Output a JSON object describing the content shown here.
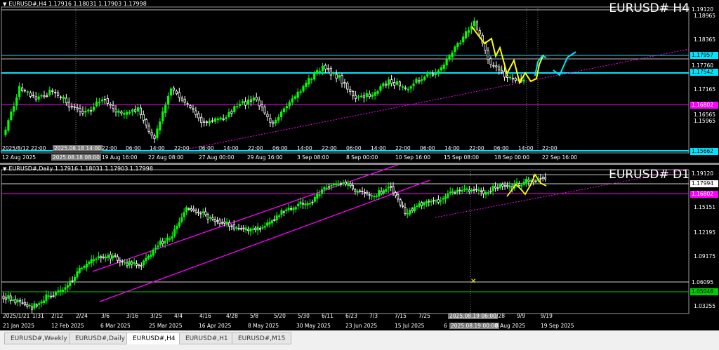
{
  "charts": [
    {
      "id": "h4",
      "header": "EURUSD#,H4  1.17916 1.18031 1.17903 1.17998",
      "watermark": "EURUSD# H4",
      "price_labels": [
        {
          "text": "1.19120",
          "bg": "#000000",
          "fg": "#ffffff"
        },
        {
          "text": "1.17957",
          "bg": "#00e5ff",
          "fg": "#000000"
        },
        {
          "text": "1.17760",
          "bg": "#000000",
          "fg": "#ffffff"
        },
        {
          "text": "1.17542",
          "bg": "#00e5ff",
          "fg": "#000000"
        },
        {
          "text": "1.16802",
          "bg": "#ff00ff",
          "fg": "#ffffff"
        },
        {
          "text": "1.15662",
          "bg": "#00e5ff",
          "fg": "#000000"
        }
      ],
      "price_ticks": [
        "1.18965",
        "1.18365",
        "1.17165",
        "1.16565",
        "1.15965"
      ],
      "time_labels": [
        "2025/8/12 22:00",
        "2025.08.18 14:00",
        "22:00",
        "06:00",
        "14:00",
        "22:00",
        "06:00",
        "14:00",
        "22:00",
        "06:00",
        "14:00",
        "22:00",
        "06:00",
        "14:00",
        "22:00",
        "06:00",
        "14:00",
        "22:00",
        "06:00",
        "14:00",
        "22:00"
      ],
      "time_labels_bottom": [
        "12 Aug 2025",
        "2025.08.18 08:00",
        "19 Aug 16:00",
        "22 Aug 08:00",
        "27 Aug 00:00",
        "29 Aug 16:00",
        "3 Sep 08:00",
        "8 Sep 00:00",
        "10 Sep 16:00",
        "15 Sep 08:00",
        "18 Sep 00:00",
        "22 Sep 16:00"
      ]
    },
    {
      "id": "d1",
      "header": "EURUSD#,Daily  1.17916 1.18031 1.17903 1.17998",
      "watermark": "EURUSD# D1",
      "price_labels": [
        {
          "text": "1.19120",
          "bg": "#000000",
          "fg": "#ffffff"
        },
        {
          "text": "1.17994",
          "bg": "#ffffff",
          "fg": "#000000"
        },
        {
          "text": "1.16802",
          "bg": "#ff00ff",
          "fg": "#ffffff"
        },
        {
          "text": "1.06095",
          "bg": "#000000",
          "fg": "#ffffff"
        },
        {
          "text": "1.05046",
          "bg": "#00cc00",
          "fg": "#000000"
        }
      ],
      "price_ticks": [
        "1.15151",
        "1.12195",
        "1.09175",
        "1.03255"
      ],
      "time_labels": [
        "2025/1/21",
        "1/31",
        "2/12",
        "2/24",
        "3/6",
        "3/16",
        "3/25",
        "4/4",
        "4/16",
        "4/28",
        "5/8",
        "5/20",
        "5/30",
        "6/11",
        "6/23",
        "7/3",
        "7/15",
        "7/25",
        "2025.08.19 06:00",
        "/28",
        "9/9",
        "9/19"
      ],
      "time_labels_bottom": [
        "21 Jan 2025",
        "12 Feb 2025",
        "6 Mar 2025",
        "25 Mar 2025",
        "16 Apr 2025",
        "8 May 2025",
        "30 May 2025",
        "23 Jun 2025",
        "15 Jul 2025",
        "6",
        "2025.08.19 00:00",
        "8 Aug 2025",
        "19 Sep 2025"
      ]
    }
  ],
  "tabs": [
    "EURUSD#,Weekly",
    "EURUSD#,Daily",
    "EURUSD#,H4",
    "EURUSD#,H1",
    "EURUSD#,M15"
  ],
  "active_tab": "EURUSD#,H4",
  "colors": {
    "bull": "#00ff00",
    "bear": "#ffffff",
    "cyan": "#00e5ff",
    "magenta": "#ff00ff",
    "yellow": "#ffff00"
  }
}
